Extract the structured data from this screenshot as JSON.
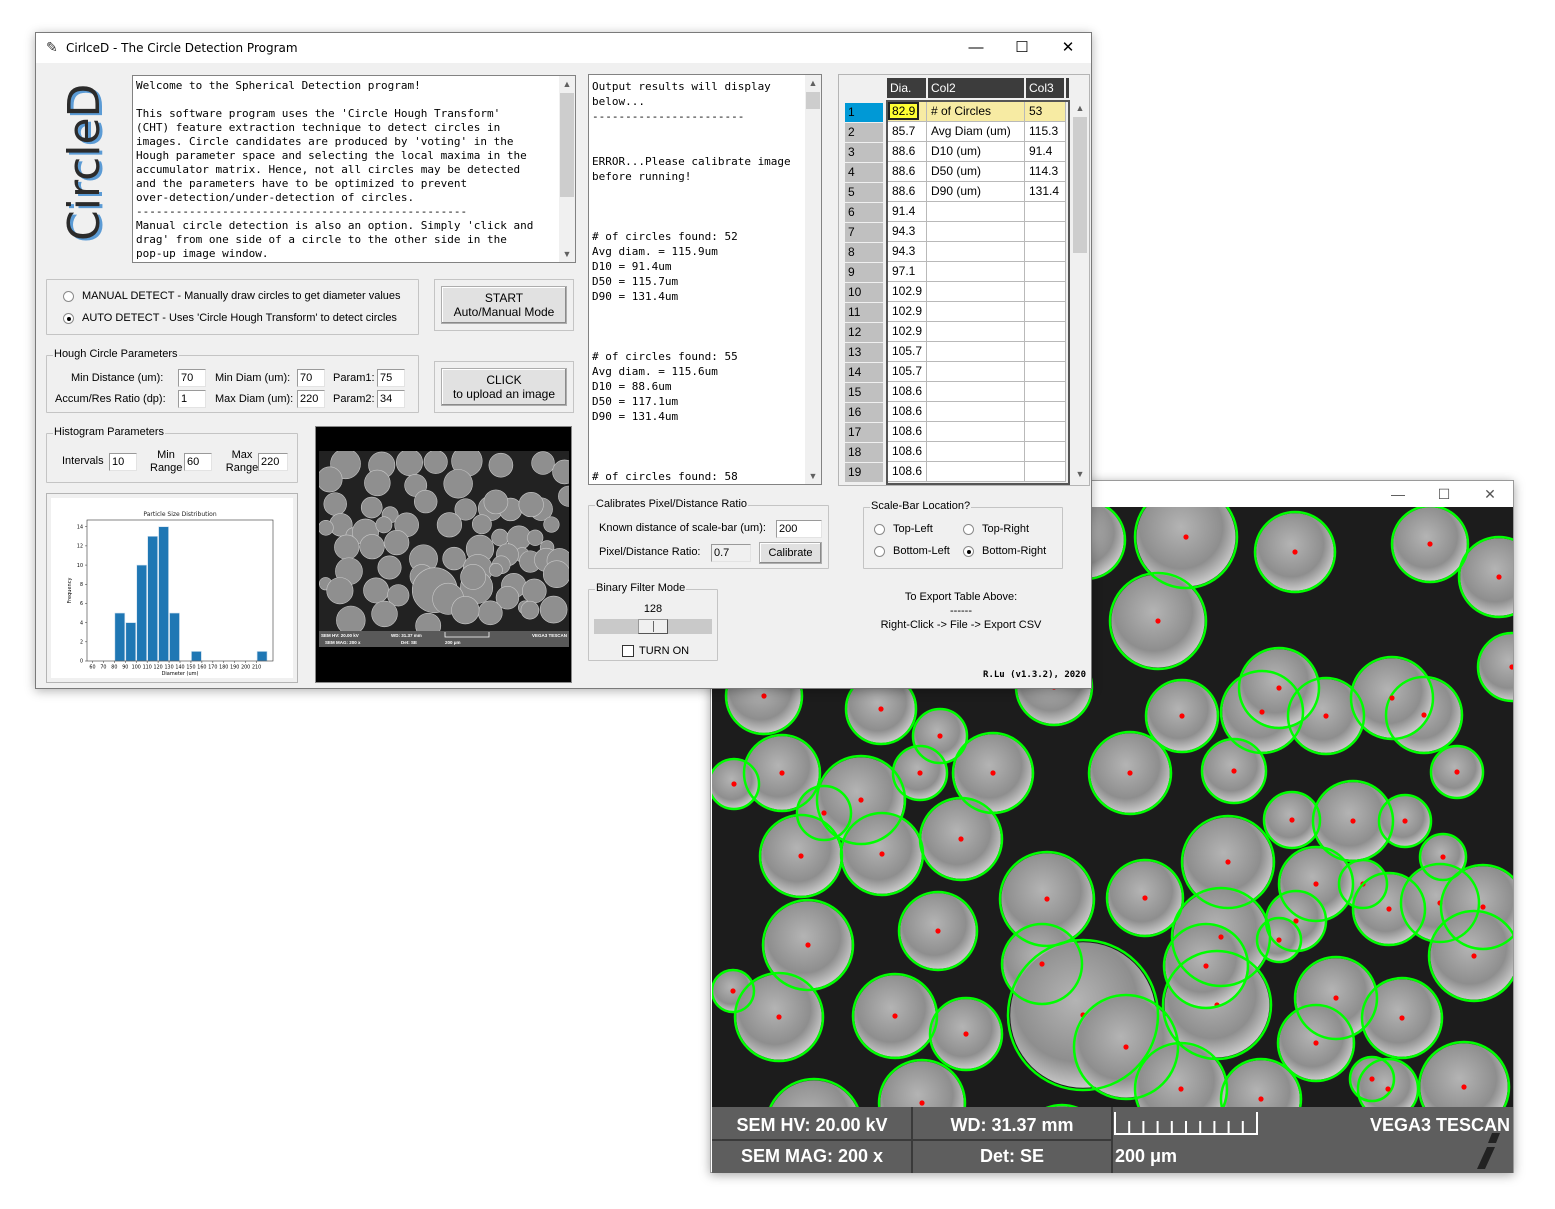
{
  "window": {
    "title": "CirlceD - The Circle Detection Program",
    "icon": "feather-icon",
    "controls": {
      "minimize": "—",
      "maximize": "☐",
      "close": "✕"
    }
  },
  "logo": {
    "text": "CircleD"
  },
  "intro_text": "Welcome to the Spherical Detection program!\n\nThis software program uses the 'Circle Hough Transform'\n(CHT) feature extraction technique to detect circles in\nimages. Circle candidates are produced by 'voting' in the\nHough parameter space and selecting the local maxima in the\naccumulator matrix. Hence, not all circles may be detected\nand the parameters have to be optimized to prevent\nover-detection/under-detection of circles.\n--------------------------------------------------\nManual circle detection is also an option. Simply 'click and\ndrag' from one side of a circle to the other side in the\npop-up image window.",
  "mode": {
    "options": [
      {
        "label": "MANUAL DETECT - Manually draw circles to get diameter values",
        "selected": false
      },
      {
        "label": "AUTO DETECT - Uses 'Circle Hough Transform' to detect circles",
        "selected": true
      }
    ],
    "start_button": {
      "line1": "START",
      "line2": "Auto/Manual Mode"
    }
  },
  "hough": {
    "legend": "Hough Circle Parameters",
    "min_distance_label": "Min Distance (um):",
    "min_distance": "70",
    "accum_label": "Accum/Res Ratio (dp):",
    "accum": "1",
    "min_diam_label": "Min Diam (um):",
    "min_diam": "70",
    "max_diam_label": "Max Diam (um):",
    "max_diam": "220",
    "param1_label": "Param1:",
    "param1": "75",
    "param2_label": "Param2:",
    "param2": "34"
  },
  "upload_button": {
    "line1": "CLICK",
    "line2": "to upload an image"
  },
  "histogram_params": {
    "legend": "Histogram Parameters",
    "intervals_label": "Intervals",
    "intervals": "10",
    "min_range_label1": "Min",
    "min_range_label2": "Range",
    "min_range": "60",
    "max_range_label1": "Max",
    "max_range_label2": "Range",
    "max_range": "220"
  },
  "chart_data": {
    "type": "bar",
    "title": "Particle Size Distribution",
    "xlabel": "Diameter (um)",
    "ylabel": "Frequency",
    "bin_width": 10,
    "bins": [
      80,
      90,
      100,
      110,
      120,
      130,
      150,
      210
    ],
    "values": [
      5,
      4,
      10,
      13,
      14,
      5,
      1,
      1
    ],
    "xticks": [
      "60",
      "70",
      "80",
      "90",
      "100",
      "110",
      "120",
      "130",
      "140",
      "150",
      "160",
      "170",
      "180",
      "190",
      "200",
      "210"
    ],
    "xlim": [
      55,
      225
    ],
    "ylim": [
      0,
      14.7
    ],
    "yticks": [
      0,
      2,
      4,
      6,
      8,
      10,
      12,
      14
    ],
    "color": "#1f77b4",
    "grid": false
  },
  "thumbnail": {
    "sem_hv": "SEM HV: 20.00 kV",
    "wd": "WD: 31.37 mm",
    "vendor": "VEGA3 TESCAN",
    "sem_mag": "SEM MAG: 200 x",
    "det": "Det: SE",
    "scale": "200 μm"
  },
  "output_log": "Output results will display\nbelow...\n-----------------------\n\n\nERROR...Please calibrate image\nbefore running!\n\n\n\n# of circles found: 52\nAvg diam. = 115.9um\nD10 = 91.4um\nD50 = 115.7um\nD90 = 131.4um\n\n\n\n# of circles found: 55\nAvg diam. = 115.6um\nD10 = 88.6um\nD50 = 117.1um\nD90 = 131.4um\n\n\n\n# of circles found: 58",
  "table": {
    "headers": [
      "Dia.",
      "Col2",
      "Col3"
    ],
    "rows": [
      {
        "idx": "1",
        "dia": "82.9",
        "col2": "# of Circles",
        "col3": "53"
      },
      {
        "idx": "2",
        "dia": "85.7",
        "col2": "Avg Diam (um)",
        "col3": "115.3"
      },
      {
        "idx": "3",
        "dia": "88.6",
        "col2": "D10 (um)",
        "col3": "91.4"
      },
      {
        "idx": "4",
        "dia": "88.6",
        "col2": "D50 (um)",
        "col3": "114.3"
      },
      {
        "idx": "5",
        "dia": "88.6",
        "col2": "D90 (um)",
        "col3": "131.4"
      },
      {
        "idx": "6",
        "dia": "91.4",
        "col2": "",
        "col3": ""
      },
      {
        "idx": "7",
        "dia": "94.3",
        "col2": "",
        "col3": ""
      },
      {
        "idx": "8",
        "dia": "94.3",
        "col2": "",
        "col3": ""
      },
      {
        "idx": "9",
        "dia": "97.1",
        "col2": "",
        "col3": ""
      },
      {
        "idx": "10",
        "dia": "102.9",
        "col2": "",
        "col3": ""
      },
      {
        "idx": "11",
        "dia": "102.9",
        "col2": "",
        "col3": ""
      },
      {
        "idx": "12",
        "dia": "102.9",
        "col2": "",
        "col3": ""
      },
      {
        "idx": "13",
        "dia": "105.7",
        "col2": "",
        "col3": ""
      },
      {
        "idx": "14",
        "dia": "105.7",
        "col2": "",
        "col3": ""
      },
      {
        "idx": "15",
        "dia": "108.6",
        "col2": "",
        "col3": ""
      },
      {
        "idx": "16",
        "dia": "108.6",
        "col2": "",
        "col3": ""
      },
      {
        "idx": "17",
        "dia": "108.6",
        "col2": "",
        "col3": ""
      },
      {
        "idx": "18",
        "dia": "108.6",
        "col2": "",
        "col3": ""
      },
      {
        "idx": "19",
        "dia": "108.6",
        "col2": "",
        "col3": ""
      }
    ],
    "selected_row": "1"
  },
  "calibration": {
    "legend": "Calibrates Pixel/Distance Ratio",
    "known_label": "Known distance of scale-bar (um):",
    "known_value": "200",
    "ratio_label": "Pixel/Distance Ratio:",
    "ratio_value": "0.7",
    "calibrate_button": "Calibrate"
  },
  "scalebar_location": {
    "legend": "Scale-Bar Location?",
    "options": [
      {
        "label": "Top-Left",
        "selected": false
      },
      {
        "label": "Top-Right",
        "selected": false
      },
      {
        "label": "Bottom-Left",
        "selected": false
      },
      {
        "label": "Bottom-Right",
        "selected": true
      }
    ]
  },
  "binary_filter": {
    "legend": "Binary Filter Mode",
    "slider_value": "128",
    "slider_fraction": 0.5,
    "checkbox_label": "TURN ON",
    "checked": false
  },
  "export_note": {
    "line1": "To Export Table Above:",
    "line2": "------",
    "line3": "Right-Click -> File -> Export CSV"
  },
  "version": "R.Lu (v1.3.2), 2020",
  "popup": {
    "controls": {
      "minimize": "—",
      "maximize": "☐",
      "close": "✕"
    },
    "overlay": {
      "sem_hv": "SEM HV: 20.00 kV",
      "wd": "WD: 31.37 mm",
      "vendor": "VEGA3 TESCAN",
      "sem_mag": "SEM MAG: 200 x",
      "det": "Det: SE",
      "scale": "200 μm"
    },
    "circle_color": "#00ff00",
    "center_color": "#ff0000"
  }
}
